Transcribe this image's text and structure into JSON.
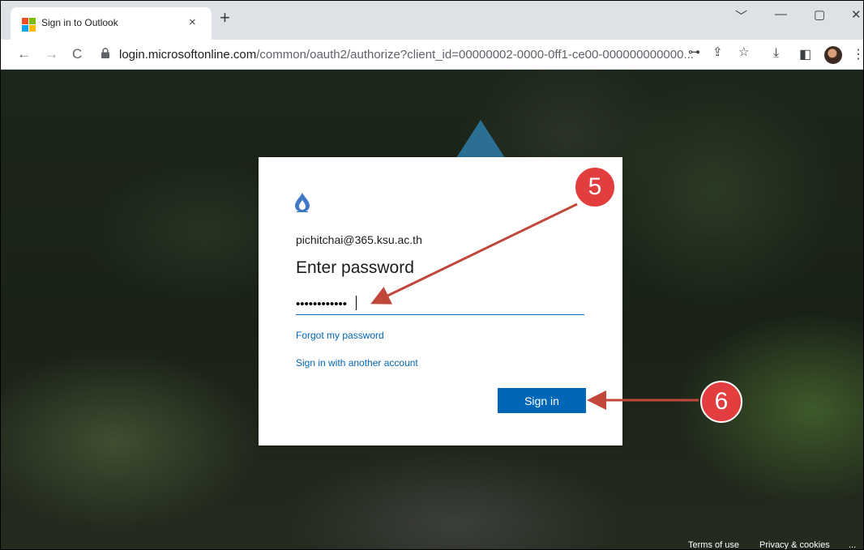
{
  "browser": {
    "tab": {
      "title": "Sign in to Outlook",
      "close_glyph": "×",
      "favicon_colors": [
        "#f25022",
        "#7fba00",
        "#00a4ef",
        "#ffb900"
      ]
    },
    "new_tab_glyph": "+",
    "window_controls": {
      "chevron": "﹀",
      "minimize": "—",
      "maximize": "▢",
      "close": "✕"
    },
    "nav": {
      "back": "←",
      "forward": "→",
      "reload": "C"
    },
    "url": {
      "host": "login.microsoftonline.com",
      "path": "/common/oauth2/authorize?client_id=00000002-0000-0ff1-ce00-000000000000..."
    },
    "omnibox_icons": [
      "key-icon",
      "share-icon",
      "star-icon"
    ],
    "toolbar_icons": [
      "download-icon",
      "side-panel-icon",
      "profile-avatar",
      "menu-icon"
    ],
    "icon_glyphs": {
      "key": "⊶",
      "share": "⇪",
      "star": "☆",
      "download": "⤓",
      "side_panel": "◧",
      "menu": "⋮"
    }
  },
  "signin": {
    "email": "pichitchai@365.ksu.ac.th",
    "heading": "Enter password",
    "password_value": "••••••••••••",
    "forgot_link": "Forgot my password",
    "another_account_link": "Sign in with another account",
    "signin_button": "Sign in",
    "accent_color": "#0067b8"
  },
  "annotations": [
    {
      "number": "5",
      "color": "#e23d3f"
    },
    {
      "number": "6",
      "color": "#e23d3f"
    }
  ],
  "footer": {
    "terms": "Terms of use",
    "privacy": "Privacy & cookies",
    "more": "..."
  }
}
